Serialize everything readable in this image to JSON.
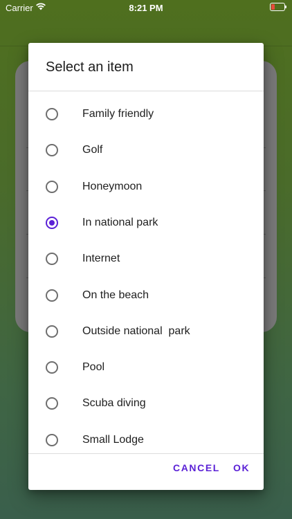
{
  "status_bar": {
    "carrier": "Carrier",
    "time": "8:21 PM",
    "wifi_icon": "wifi-icon",
    "battery_icon": "battery-charging-icon",
    "battery_color": "#e74c3c"
  },
  "dialog": {
    "title": "Select an item",
    "accent_color": "#5b21d6",
    "options": [
      {
        "label": "Family friendly",
        "selected": false
      },
      {
        "label": "Golf",
        "selected": false
      },
      {
        "label": "Honeymoon",
        "selected": false
      },
      {
        "label": "In national park",
        "selected": true
      },
      {
        "label": "Internet",
        "selected": false
      },
      {
        "label": "On the beach",
        "selected": false
      },
      {
        "label": "Outside national  park",
        "selected": false
      },
      {
        "label": "Pool",
        "selected": false
      },
      {
        "label": "Scuba diving",
        "selected": false
      },
      {
        "label": "Small Lodge",
        "selected": false
      }
    ],
    "cancel_label": "CANCEL",
    "ok_label": "OK"
  }
}
